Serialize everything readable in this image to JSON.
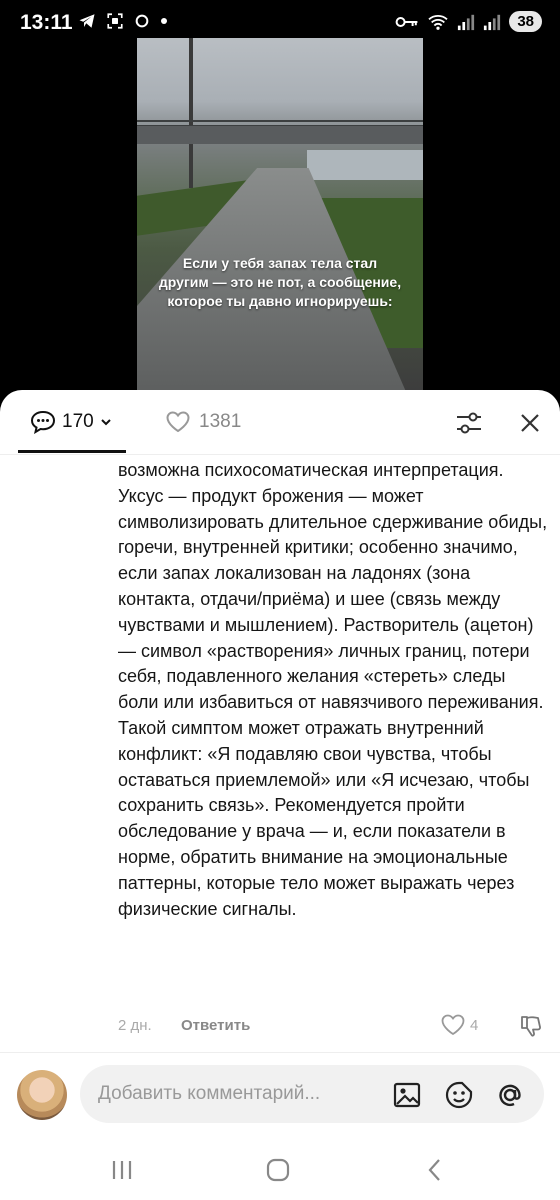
{
  "status_bar": {
    "time": "13:11",
    "battery": "38",
    "left_icons": [
      "telegram-icon",
      "screenshot-icon",
      "circle-icon",
      "dot-icon"
    ],
    "right_icons": [
      "key-icon",
      "wifi-icon",
      "signal-icon",
      "signal-icon"
    ]
  },
  "video": {
    "caption": "Если у тебя запах тела стал другим — это не пот, а сообщение, которое ты давно игнорируешь:"
  },
  "header": {
    "comments_count": "170",
    "likes_count": "1381"
  },
  "comment": {
    "paragraphs": [
      "возможна психосоматическая интерпретация. Уксус — продукт брожения — может символизировать длительное сдерживание обиды, горечи, внутренней критики; особенно значимо, если запах локализован на ладонях (зона контакта, отдачи/приёма) и шее (связь между чувствами и мышлением). Растворитель (ацетон) — символ «растворения» личных границ, потери себя, подавленного желания «стереть» следы боли или избавиться от навязчивого переживания.",
      "Такой симптом может отражать внутренний конфликт: «Я подавляю свои чувства, чтобы оставаться приемлемой» или «Я исчезаю, чтобы сохранить связь». Рекомендуется пройти обследование у врача — и, если показатели в норме, обратить внимание на эмоциональные паттерны, которые тело может выражать через физические сигналы."
    ],
    "date": "2 дн.",
    "reply_label": "Ответить",
    "like_count": "4"
  },
  "composer": {
    "placeholder": "Добавить комментарий..."
  },
  "colors": {
    "text": "#161616",
    "muted": "#999999",
    "sheet_bg": "#ffffff",
    "input_bg": "#f1f1f1"
  }
}
